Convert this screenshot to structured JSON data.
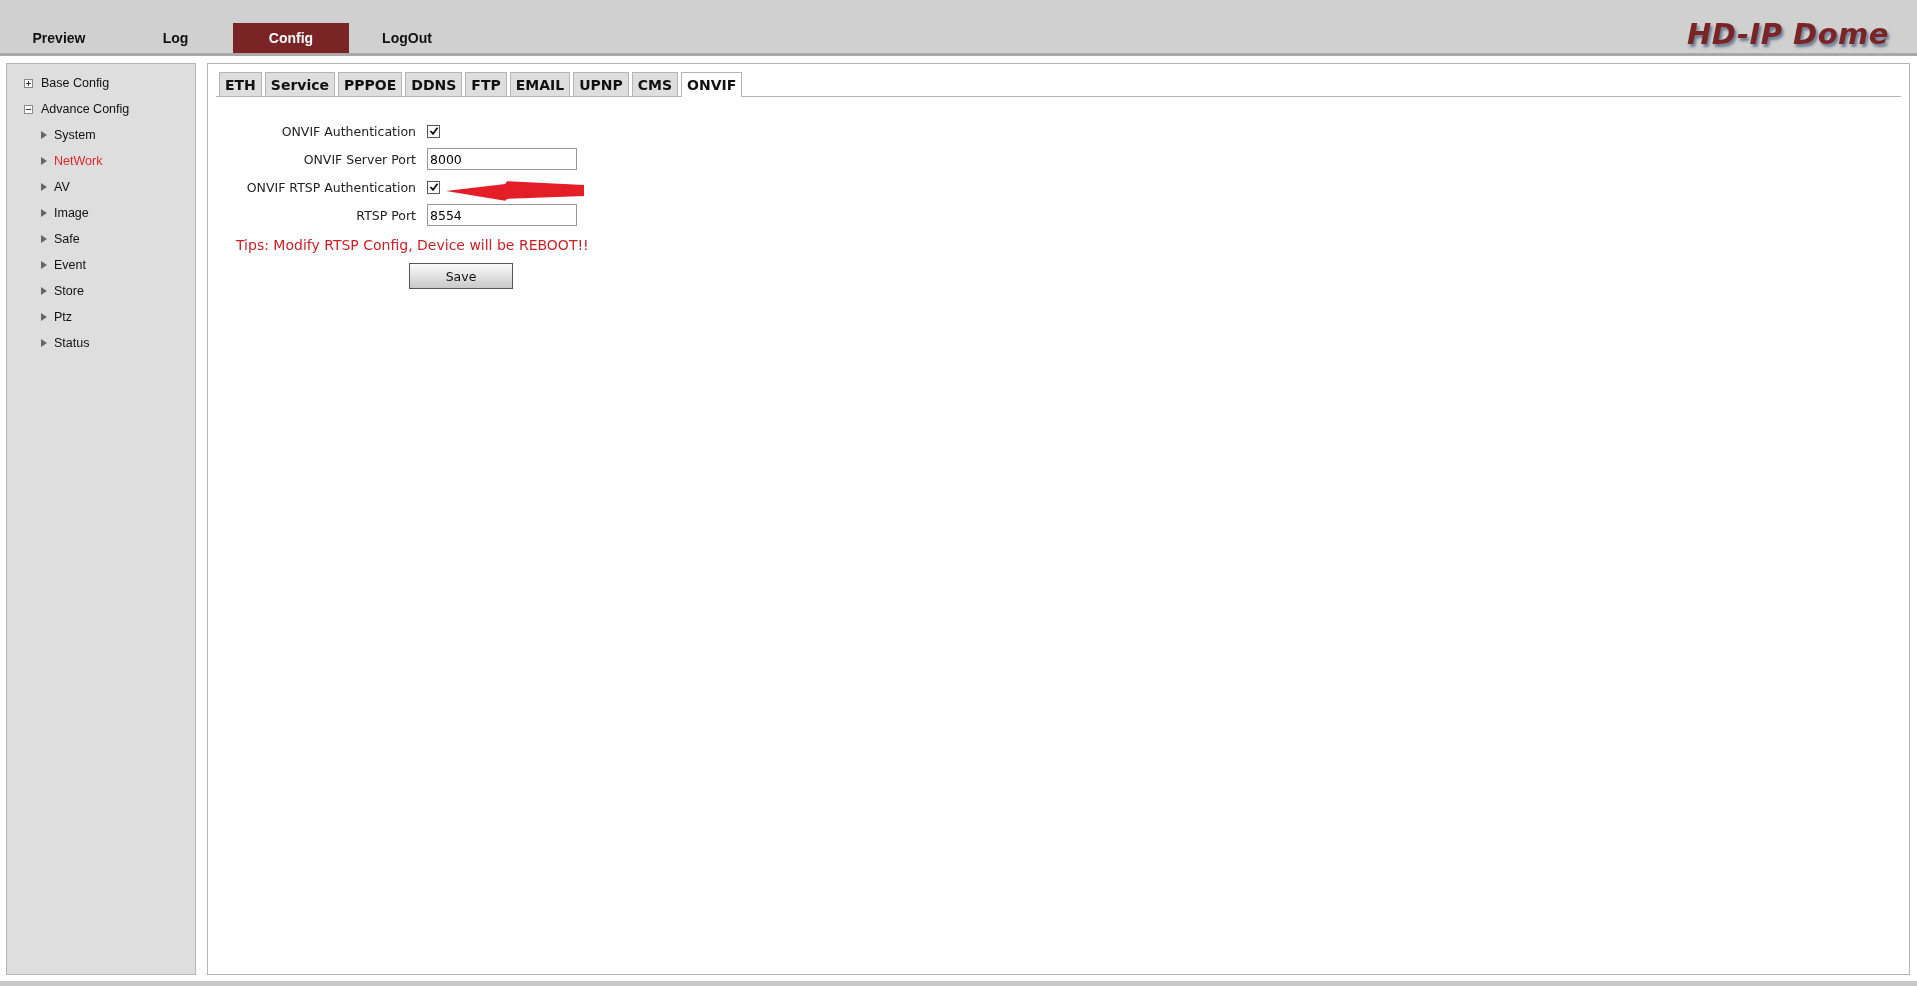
{
  "nav": [
    {
      "label": "Preview",
      "selected": false
    },
    {
      "label": "Log",
      "selected": false
    },
    {
      "label": "Config",
      "selected": true
    },
    {
      "label": "LogOut",
      "selected": false
    }
  ],
  "logo": "HD-IP Dome",
  "sidebar": {
    "items": [
      {
        "label": "Base Config",
        "expanded": false,
        "selected": false
      },
      {
        "label": "Advance Config",
        "expanded": true,
        "selected": false,
        "children": [
          {
            "label": "System",
            "selected": false
          },
          {
            "label": "NetWork",
            "selected": true
          },
          {
            "label": "AV",
            "selected": false
          },
          {
            "label": "Image",
            "selected": false
          },
          {
            "label": "Safe",
            "selected": false
          },
          {
            "label": "Event",
            "selected": false
          },
          {
            "label": "Store",
            "selected": false
          },
          {
            "label": "Ptz",
            "selected": false
          },
          {
            "label": "Status",
            "selected": false
          }
        ]
      }
    ]
  },
  "tabs": [
    {
      "label": "ETH",
      "selected": false
    },
    {
      "label": "Service",
      "selected": false
    },
    {
      "label": "PPPOE",
      "selected": false
    },
    {
      "label": "DDNS",
      "selected": false
    },
    {
      "label": "FTP",
      "selected": false
    },
    {
      "label": "EMAIL",
      "selected": false
    },
    {
      "label": "UPNP",
      "selected": false
    },
    {
      "label": "CMS",
      "selected": false
    },
    {
      "label": "ONVIF",
      "selected": true
    }
  ],
  "form": {
    "fields": [
      {
        "kind": "checkbox",
        "label": "ONVIF Authentication",
        "checked": true
      },
      {
        "kind": "text",
        "label": "ONVIF Server Port",
        "value": "8000"
      },
      {
        "kind": "checkbox",
        "label": "ONVIF RTSP Authentication",
        "checked": true
      },
      {
        "kind": "text",
        "label": "RTSP Port",
        "value": "8554"
      }
    ],
    "tip": "Tips: Modify RTSP Config, Device will be REBOOT!!",
    "save_button": "Save"
  }
}
